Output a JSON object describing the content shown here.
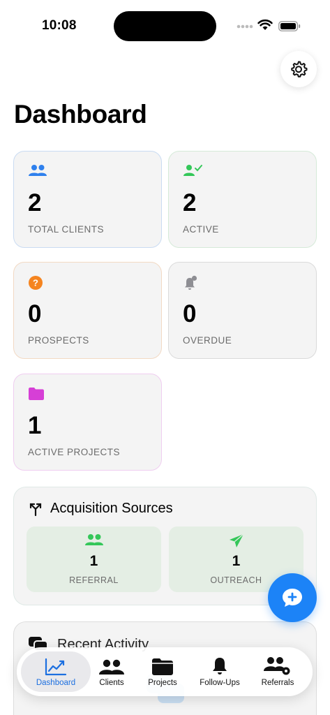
{
  "status_bar": {
    "time": "10:08"
  },
  "header": {
    "title": "Dashboard"
  },
  "stats": [
    {
      "value": "2",
      "label": "TOTAL CLIENTS",
      "icon": "people-icon",
      "color": "#2f80ed",
      "border": "#c9dbf2"
    },
    {
      "value": "2",
      "label": "ACTIVE",
      "icon": "person-check-icon",
      "color": "#34c759",
      "border": "#d5ead8"
    },
    {
      "value": "0",
      "label": "PROSPECTS",
      "icon": "question-circle-icon",
      "color": "#f5841f",
      "border": "#f2d9c3"
    },
    {
      "value": "0",
      "label": "OVERDUE",
      "icon": "bell-badge-icon",
      "color": "#8e8e93",
      "border": "#dadada"
    },
    {
      "value": "1",
      "label": "ACTIVE PROJECTS",
      "icon": "folder-icon",
      "color": "#d63fd6",
      "border": "#efcdf0"
    }
  ],
  "acquisition": {
    "title": "Acquisition Sources",
    "sources": [
      {
        "value": "1",
        "label": "REFERRAL",
        "icon": "people-icon",
        "color": "#34c759"
      },
      {
        "value": "1",
        "label": "OUTREACH",
        "icon": "paperplane-icon",
        "color": "#34c759"
      }
    ]
  },
  "recent": {
    "title": "Recent Activity"
  },
  "tabs": [
    {
      "label": "Dashboard",
      "icon": "chart-line-icon",
      "active": true
    },
    {
      "label": "Clients",
      "icon": "people-icon"
    },
    {
      "label": "Projects",
      "icon": "folder-icon"
    },
    {
      "label": "Follow-Ups",
      "icon": "bell-icon"
    },
    {
      "label": "Referrals",
      "icon": "people-gear-icon"
    }
  ],
  "colors": {
    "accent": "#1c83f7"
  }
}
